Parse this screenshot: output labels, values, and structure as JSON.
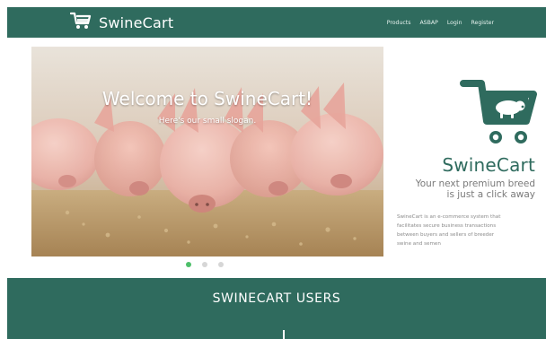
{
  "navbar": {
    "brand_name": "SwineCart",
    "links": [
      "Products",
      "ASBAP",
      "Login",
      "Register"
    ]
  },
  "hero": {
    "title": "Welcome to SwineCart!",
    "slogan": "Here's our small slogan."
  },
  "carousel": {
    "active_index": 0,
    "slide_count": 3
  },
  "info": {
    "title": "SwineCart",
    "tagline_line1": "Your next premium breed",
    "tagline_line2": "is just a click away",
    "description_lines": [
      "SwineCart is an e-commerce system that",
      "facilitates secure business transactions",
      "between buyers and sellers of breeder",
      "swine and semen"
    ]
  },
  "users_section": {
    "title": "SWINECART USERS"
  },
  "colors": {
    "primary": "#2f6b5e",
    "accent_dot": "#4dbf6a"
  },
  "icons": {
    "brand": "cart-icon",
    "logo": "cart-with-pig-logo"
  }
}
